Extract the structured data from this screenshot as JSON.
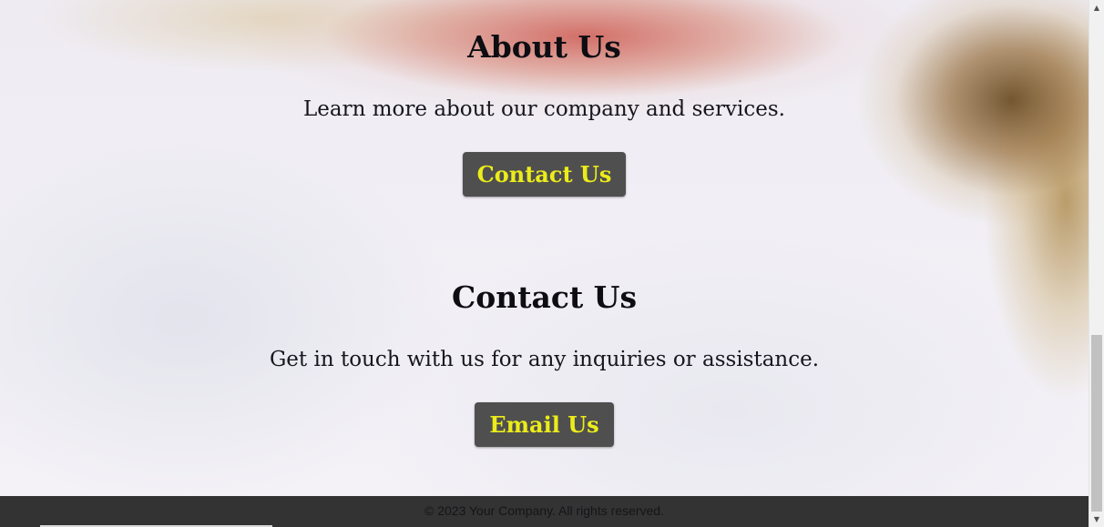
{
  "about": {
    "heading": "About Us",
    "text": "Learn more about our company and services.",
    "button_label": "Contact Us"
  },
  "contact": {
    "heading": "Contact Us",
    "text": "Get in touch with us for any inquiries or assistance.",
    "button_label": "Email Us"
  },
  "footer": {
    "copyright": "© 2023 Your Company. All rights reserved."
  },
  "scrollbar": {
    "up_icon": "triangle-up",
    "down_icon": "triangle-down"
  },
  "colors": {
    "button_bg": "#4f4f4f",
    "button_text": "#ecec1a",
    "footer_bg": "#333333"
  }
}
